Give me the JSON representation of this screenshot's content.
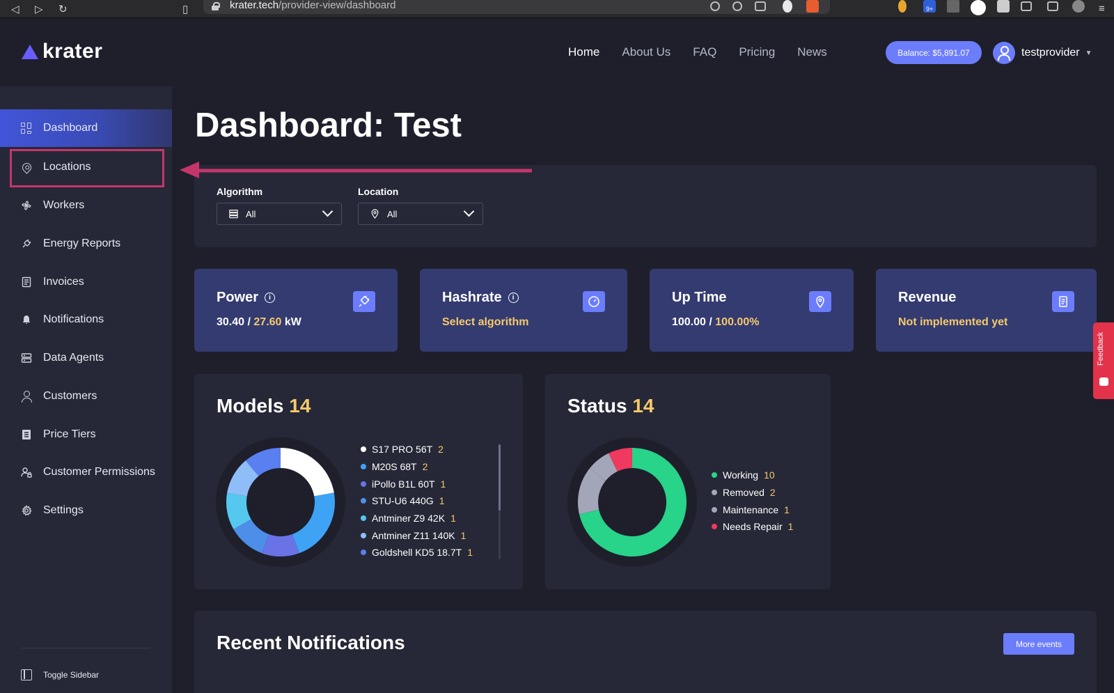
{
  "browser": {
    "url_host": "krater.tech",
    "url_path": "/provider-view/dashboard",
    "ext_badge": "9+"
  },
  "header": {
    "logo_text": "krater",
    "nav": [
      {
        "label": "Home",
        "active": true
      },
      {
        "label": "About Us",
        "active": false
      },
      {
        "label": "FAQ",
        "active": false
      },
      {
        "label": "Pricing",
        "active": false
      },
      {
        "label": "News",
        "active": false
      }
    ],
    "balance": "Balance: $5,891.07",
    "username": "testprovider"
  },
  "sidebar": {
    "items": [
      {
        "label": "Dashboard",
        "icon": "dashboard-grid-icon",
        "active": true
      },
      {
        "label": "Locations",
        "icon": "map-pin-icon",
        "active": false
      },
      {
        "label": "Workers",
        "icon": "fan-icon",
        "active": false
      },
      {
        "label": "Energy Reports",
        "icon": "plug-icon",
        "active": false
      },
      {
        "label": "Invoices",
        "icon": "invoice-icon",
        "active": false
      },
      {
        "label": "Notifications",
        "icon": "bell-icon",
        "active": false
      },
      {
        "label": "Data Agents",
        "icon": "server-icon",
        "active": false
      },
      {
        "label": "Customers",
        "icon": "person-icon",
        "active": false
      },
      {
        "label": "Price Tiers",
        "icon": "list-icon",
        "active": false
      },
      {
        "label": "Customer Permissions",
        "icon": "person-lock-icon",
        "active": false
      },
      {
        "label": "Settings",
        "icon": "gear-icon",
        "active": false
      }
    ],
    "toggle_label": "Toggle Sidebar"
  },
  "main": {
    "title": "Dashboard: Test",
    "filters": {
      "algorithm_label": "Algorithm",
      "algorithm_value": "All",
      "location_label": "Location",
      "location_value": "All"
    },
    "cards": {
      "power": {
        "title": "Power",
        "value_a": "30.40",
        "sep": " / ",
        "value_b": "27.60",
        "unit": " kW",
        "icon": "plug-icon"
      },
      "hashrate": {
        "title": "Hashrate",
        "value": "Select algorithm",
        "icon": "gauge-icon"
      },
      "uptime": {
        "title": "Up Time",
        "value_a": "100.00",
        "sep": " / ",
        "value_b": "100.00%",
        "icon": "map-pin-icon"
      },
      "revenue": {
        "title": "Revenue",
        "value": "Not implemented yet",
        "icon": "receipt-icon"
      }
    },
    "models": {
      "title": "Models",
      "count": "14",
      "items": [
        {
          "name": "S17 PRO 56T",
          "count": 2,
          "color": "#ffffff"
        },
        {
          "name": "M20S 68T",
          "count": 2,
          "color": "#3ea3f5"
        },
        {
          "name": "iPollo B1L 60T",
          "count": 1,
          "color": "#6a73e6"
        },
        {
          "name": "STU-U6 440G",
          "count": 1,
          "color": "#4d8ee8"
        },
        {
          "name": "Antminer Z9 42K",
          "count": 1,
          "color": "#55c8f0"
        },
        {
          "name": "Antminer Z11 140K",
          "count": 1,
          "color": "#8fbdf7"
        },
        {
          "name": "Goldshell KD5 18.7T",
          "count": 1,
          "color": "#5a7ff0"
        }
      ]
    },
    "status": {
      "title": "Status",
      "count": "14",
      "items": [
        {
          "name": "Working",
          "count": 10,
          "color": "#28d38a"
        },
        {
          "name": "Removed",
          "count": 2,
          "color": "#a3a6b8"
        },
        {
          "name": "Maintenance",
          "count": 1,
          "color": "#a3a6b8"
        },
        {
          "name": "Needs Repair",
          "count": 1,
          "color": "#f0395e"
        }
      ]
    },
    "recent": {
      "title": "Recent Notifications",
      "more_button": "More events"
    }
  },
  "feedback_label": "Feedback"
}
